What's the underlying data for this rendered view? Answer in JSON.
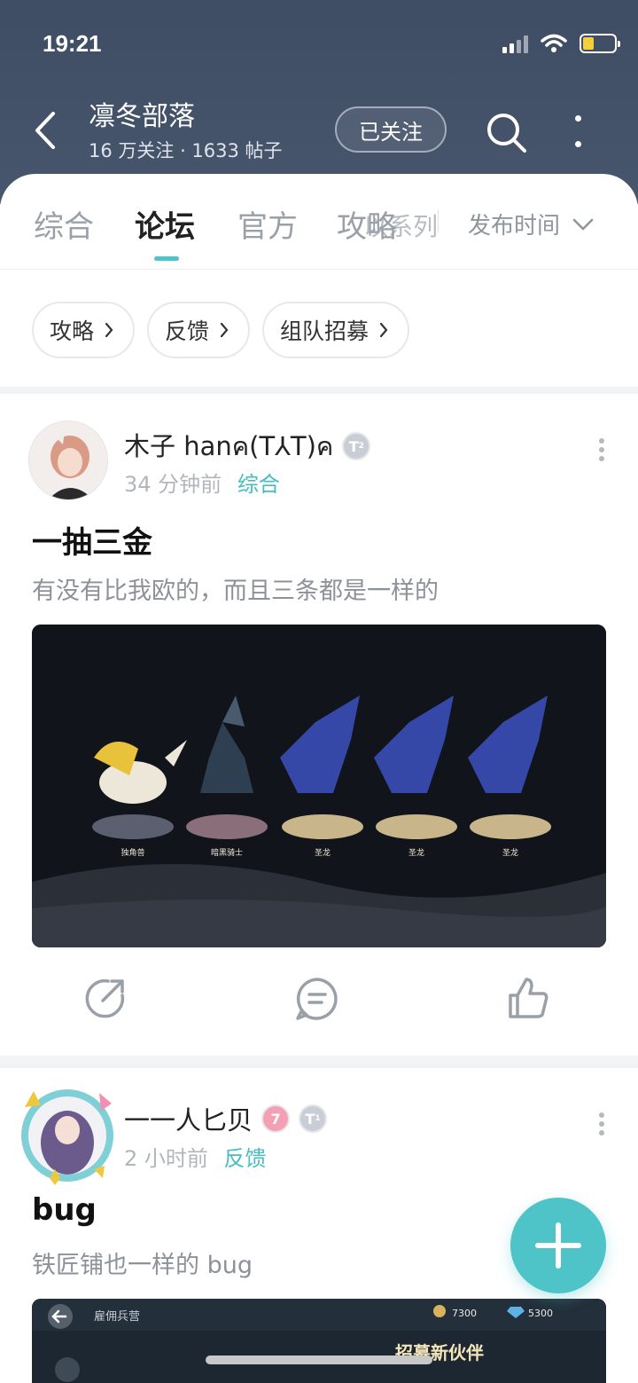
{
  "status_bar": {
    "time": "19:21"
  },
  "header": {
    "title": "凛冬部落",
    "stats": "16 万关注 · 1633 帖子",
    "follow_label": "已关注"
  },
  "tabs": {
    "items": [
      "综合",
      "论坛",
      "官方",
      "攻略"
    ],
    "active_index": 1,
    "ghost_label": "以系列",
    "sort_label": "发布时间"
  },
  "chips": [
    "攻略",
    "反馈",
    "组队招募"
  ],
  "posts": [
    {
      "author": "木子 hanค(T⅄T)ค",
      "badge": "T",
      "badge_level": "2",
      "time": "34 分钟前",
      "section": "综合",
      "title": "一抽三金",
      "body": "有没有比我欧的，而且三条都是一样的",
      "image_labels": [
        "独角兽",
        "暗黑骑士",
        "圣龙",
        "圣龙",
        "圣龙"
      ]
    },
    {
      "author": "一一人匕贝",
      "badge_pink": "7",
      "badge": "T",
      "badge_level": "1",
      "time": "2 小时前",
      "section": "反馈",
      "title": "bug",
      "body": "铁匠铺也一样的 bug",
      "image_top_left": "雇佣兵营",
      "image_gold": "7300",
      "image_gem": "5300",
      "image_banner": "招募新伙伴"
    }
  ],
  "colors": {
    "header_bg": "#44526a",
    "accent": "#4fc4c8"
  }
}
